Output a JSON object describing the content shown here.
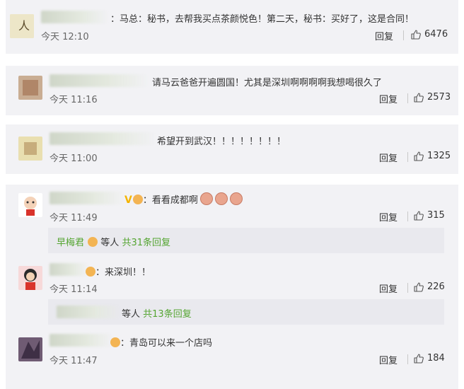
{
  "comments": [
    {
      "text": "：马总：秘书，去帮我买点茶颜悦色！第二天，秘书：买好了，这是合同！",
      "time": "今天 12:10",
      "reply": "回复",
      "likes": "6476"
    },
    {
      "text": "请马云爸爸开遍圆国！尤其是深圳啊啊啊啊我想喝很久了",
      "time": "今天 11:16",
      "reply": "回复",
      "likes": "2573"
    },
    {
      "text": "希望开到武汉！！！！！！！！",
      "time": "今天 11:00",
      "reply": "回复",
      "likes": "1325"
    },
    {
      "text": "：看看成都啊",
      "time": "今天 11:49",
      "reply": "回复",
      "likes": "315",
      "sub": {
        "name": "早梅君",
        "middle": "等人",
        "count": "共31条回复"
      }
    },
    {
      "text": "：来深圳！！",
      "time": "今天 11:14",
      "reply": "回复",
      "likes": "226",
      "sub": {
        "middle": "等人",
        "count": "共13条回复"
      }
    },
    {
      "text": "：青岛可以来一个店吗",
      "time": "今天 11:47",
      "reply": "回复",
      "likes": "184"
    }
  ],
  "icons": {
    "like": "thumbs-up-icon",
    "badge": "vip-v-icon"
  },
  "colors": {
    "card_bg": "#f2f2f5",
    "sub_bg": "#e9e9ee",
    "link_green": "#55a532"
  }
}
